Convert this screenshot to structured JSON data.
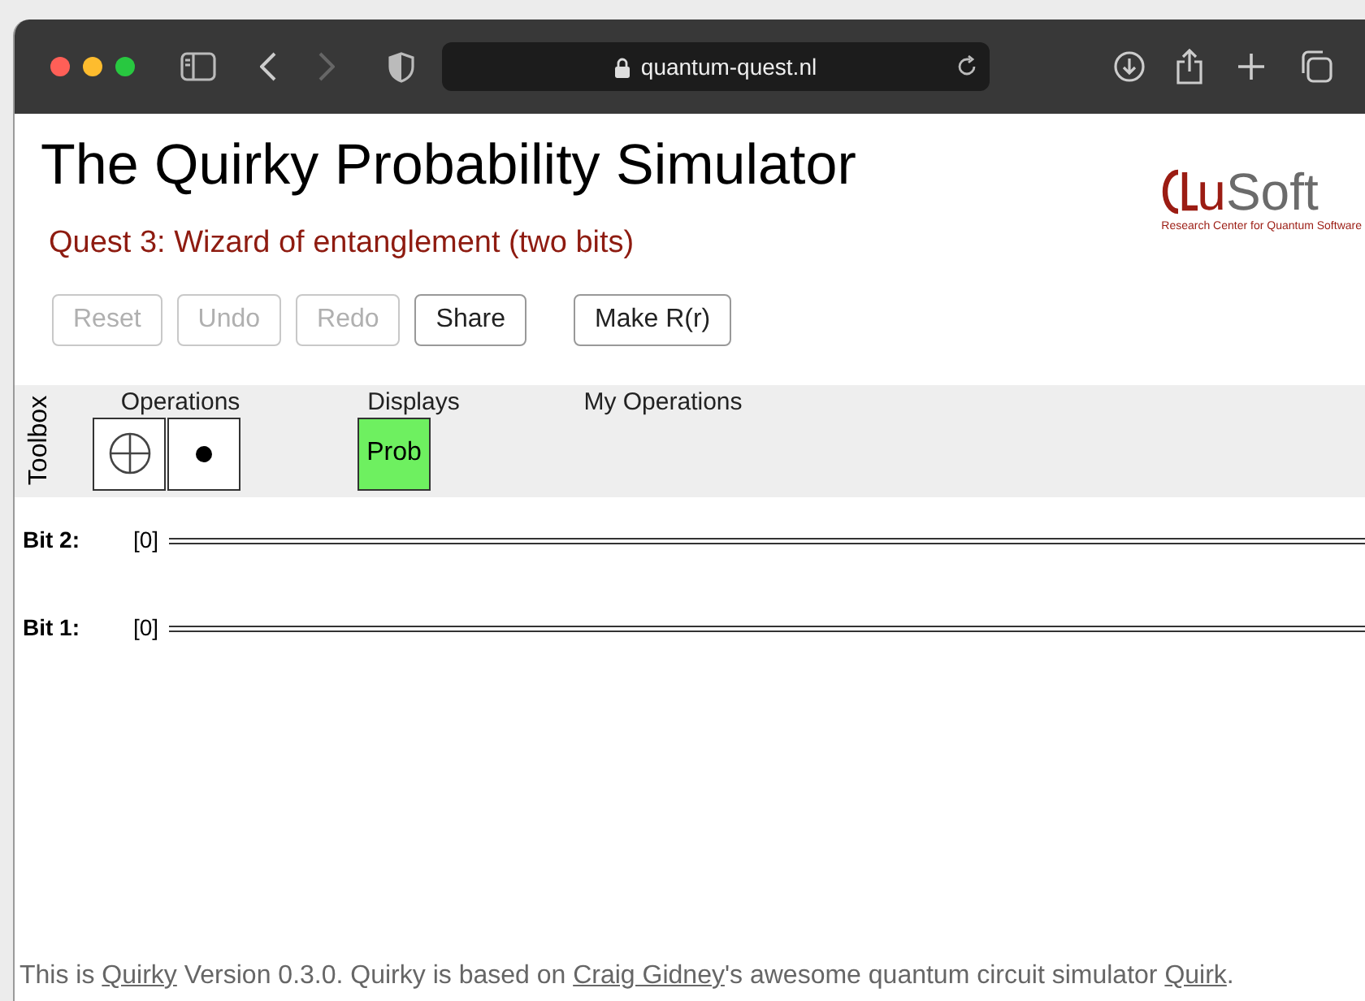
{
  "browser": {
    "url": "quantum-quest.nl"
  },
  "page": {
    "title": "The Quirky Probability Simulator",
    "subtitle": "Quest 3: Wizard of entanglement (two bits)",
    "logo": {
      "accent": "u",
      "text": "Soft",
      "tagline": "Research Center for Quantum Software"
    }
  },
  "buttons": [
    {
      "label": "Reset",
      "disabled": true
    },
    {
      "label": "Undo",
      "disabled": true
    },
    {
      "label": "Redo",
      "disabled": true
    },
    {
      "label": "Share",
      "disabled": false
    },
    {
      "label": "Make R(r)",
      "disabled": false
    }
  ],
  "toolbox": {
    "label": "Toolbox",
    "sections": [
      {
        "title": "Operations",
        "gates": [
          {
            "kind": "xor"
          },
          {
            "kind": "control"
          }
        ]
      },
      {
        "title": "Displays",
        "gates": [
          {
            "kind": "display",
            "label": "Prob"
          }
        ]
      },
      {
        "title": "My Operations"
      }
    ]
  },
  "wires": [
    {
      "label": "Bit 2:",
      "value": "[0]"
    },
    {
      "label": "Bit 1:",
      "value": "[0]"
    }
  ],
  "footer": [
    {
      "kind": "text",
      "text": "This is "
    },
    {
      "kind": "link",
      "text": "Quirky"
    },
    {
      "kind": "text",
      "text": " Version 0.3.0. Quirky is based on "
    },
    {
      "kind": "link",
      "text": "Craig Gidney"
    },
    {
      "kind": "text",
      "text": "'s awesome quantum circuit simulator "
    },
    {
      "kind": "link",
      "text": "Quirk"
    },
    {
      "kind": "text",
      "text": "."
    }
  ]
}
